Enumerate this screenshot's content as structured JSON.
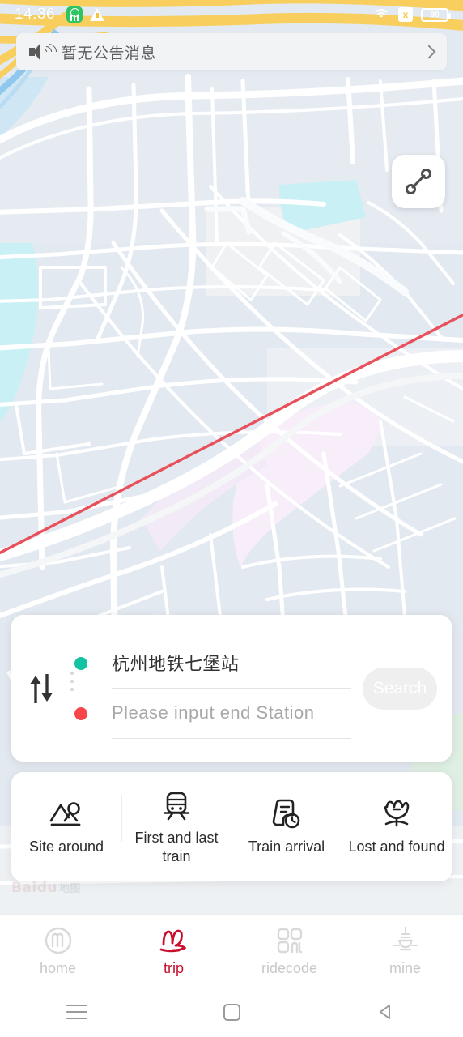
{
  "status_bar": {
    "time": "14:36",
    "app_badge_icon": "green-app-icon",
    "warning_icon": "warning-triangle-icon",
    "wifi_icon": "wifi-icon",
    "sim_icon": "sim-x-icon",
    "sim_label": "x",
    "battery_icon": "battery-icon",
    "battery_label": "90"
  },
  "announcement": {
    "speaker_icon": "speaker-icon",
    "text": "暂无公告消息",
    "chevron_icon": "chevron-right-icon"
  },
  "map": {
    "route_fab_icon": "route-path-icon",
    "watermark": "Baidu",
    "watermark_cn": "地图",
    "base_color": "#e3e9f0",
    "road_color": "#ffffff",
    "water_color": "#c9f0f5",
    "highway_color": "#f8cf5e",
    "metro_line_color": "#e8505b",
    "park_color": "#f7eefa"
  },
  "search_card": {
    "swap_icon": "swap-vertical-icon",
    "start": {
      "dot_color": "#12c2a0",
      "value": "杭州地铁七堡站"
    },
    "end": {
      "dot_color": "#f7464a",
      "placeholder": "Please input end Station",
      "value": ""
    },
    "search_label": "Search",
    "search_enabled": false
  },
  "quick_actions": [
    {
      "id": "site-around",
      "icon": "landscape-icon",
      "label": "Site around"
    },
    {
      "id": "first-last-train",
      "icon": "train-front-icon",
      "label": "First and last train"
    },
    {
      "id": "train-arrival",
      "icon": "document-clock-icon",
      "label": "Train arrival"
    },
    {
      "id": "lost-and-found",
      "icon": "tulip-flower-icon",
      "label": "Lost and found"
    }
  ],
  "bottom_nav": {
    "active_color": "#c8102e",
    "inactive_color": "#c8c8c8",
    "items": [
      {
        "id": "home",
        "icon": "metro-logo-icon",
        "label": "home",
        "active": false
      },
      {
        "id": "trip",
        "icon": "trip-brush-icon",
        "label": "trip",
        "active": true
      },
      {
        "id": "ridecode",
        "icon": "qr-code-icon",
        "label": "ridecode",
        "active": false
      },
      {
        "id": "mine",
        "icon": "pagoda-icon",
        "label": "mine",
        "active": false
      }
    ]
  },
  "android_nav": {
    "recents_icon": "menu-lines-icon",
    "home_icon": "square-icon",
    "back_icon": "triangle-back-icon"
  }
}
